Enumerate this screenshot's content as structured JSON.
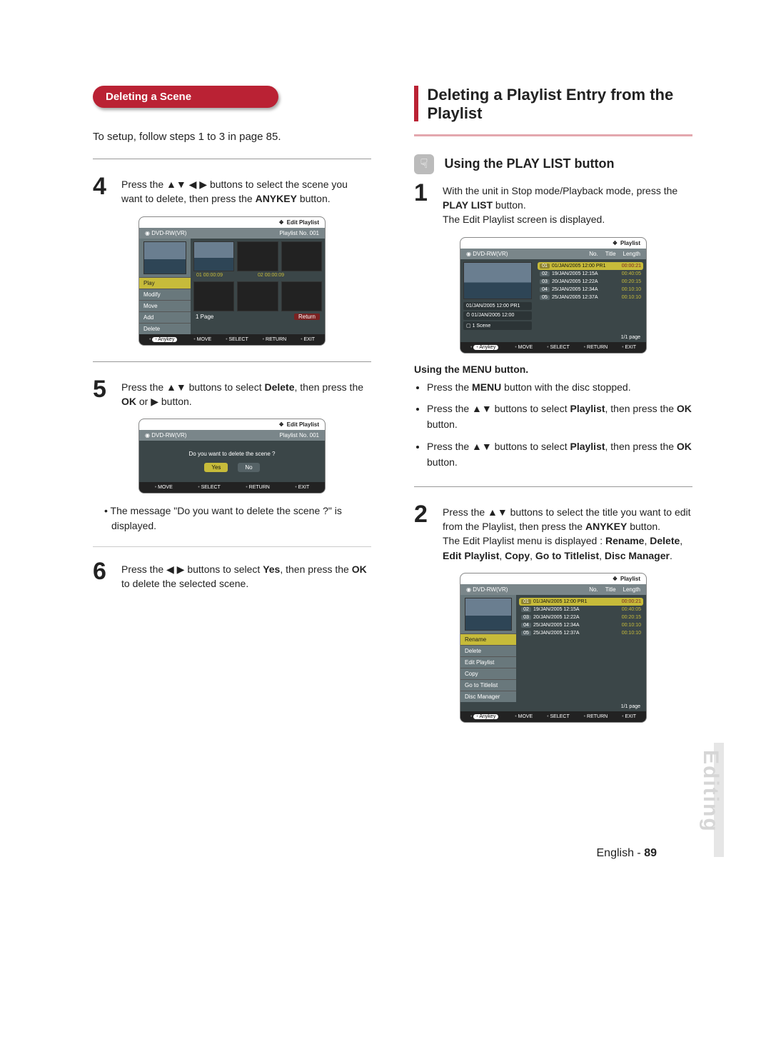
{
  "left": {
    "pill": "Deleting a Scene",
    "lead": "To setup, follow steps 1 to 3 in page 85.",
    "step4": {
      "num": "4",
      "body_pre": "Press the ▲▼ ◀ ▶ buttons to select the scene you want to delete, then press the ",
      "bold": "ANYKEY",
      "body_post": " button."
    },
    "step5": {
      "num": "5",
      "body_pre": "Press the ▲▼ buttons to select ",
      "bold1": "Delete",
      "mid": ", then press the ",
      "bold2": "OK",
      "mid2": " or ▶ button."
    },
    "note": "• The message \"Do you want to delete the scene ?\" is displayed.",
    "step6": {
      "num": "6",
      "body_pre": "Press the ◀ ▶ buttons to select ",
      "bold1": "Yes",
      "mid": ",\nthen press the ",
      "bold2": "OK",
      "post": " to delete the selected scene."
    }
  },
  "mini1": {
    "title": "Edit Playlist",
    "disc": "DVD-RW(VR)",
    "plist": "Playlist No. 001",
    "menu": [
      "Play",
      "Modify",
      "Move",
      "Add",
      "Delete"
    ],
    "pageinfo": "1 Page",
    "splits": [
      "00:00:09",
      "00:00:09"
    ],
    "foot_key": "Anykey",
    "foot": [
      "MOVE",
      "SELECT",
      "RETURN",
      "EXIT"
    ]
  },
  "mini2": {
    "title": "Edit Playlist",
    "disc": "DVD-RW(VR)",
    "plist": "Playlist No. 001",
    "msg": "Do you want to delete the scene ?",
    "yes": "Yes",
    "no": "No",
    "foot": [
      "MOVE",
      "SELECT",
      "RETURN",
      "EXIT"
    ]
  },
  "right": {
    "heading": "Deleting a Playlist Entry from the Playlist",
    "sub": "Using the PLAY LIST button",
    "step1": {
      "num": "1",
      "pre": "With the unit in Stop mode/Playback mode, press the ",
      "bold": "PLAY LIST",
      "mid": " button.",
      "line2": "The Edit Playlist screen is displayed."
    },
    "menutitle": "Using the MENU button.",
    "bullets": [
      "Press the MENU button with the disc stopped.",
      "Press the ▲▼ buttons to select Playlist, then press the OK button.",
      "Press the ▲▼ buttons to select Playlist, then press the OK button."
    ],
    "step2": {
      "num": "2",
      "line1": "Press the ▲▼ buttons to select the title you want to edit from the Playlist, then press the ANYKEY button.",
      "line2": "The Edit Playlist menu is displayed : Rename, Delete, Edit Playlist, Copy, Go to Titlelist, Disc Manager."
    }
  },
  "mini3": {
    "title": "Playlist",
    "disc": "DVD-RW(VR)",
    "cols": [
      "No.",
      "Title",
      "Length"
    ],
    "rows": [
      {
        "no": "01",
        "title": "01/JAN/2005 12:00 PR1",
        "len": "00:00:21"
      },
      {
        "no": "02",
        "title": "19/JAN/2005 12:15A",
        "len": "00:40:05"
      },
      {
        "no": "03",
        "title": "20/JAN/2005 12:22A",
        "len": "00:20:15"
      },
      {
        "no": "04",
        "title": "25/JAN/2005 12:34A",
        "len": "00:10:10"
      },
      {
        "no": "05",
        "title": "25/JAN/2005 12:37A",
        "len": "00:10:10"
      }
    ],
    "side": [
      "01/JAN/2005 12:00 PR1",
      "01/JAN/2005 12:00",
      "1 Scene"
    ],
    "page": "1/1 page",
    "foot_key": "Anykey",
    "foot": [
      "MOVE",
      "SELECT",
      "RETURN",
      "EXIT"
    ]
  },
  "mini4": {
    "title": "Playlist",
    "disc": "DVD-RW(VR)",
    "cols": [
      "No.",
      "Title",
      "Length"
    ],
    "rows": [
      {
        "no": "01",
        "title": "01/JAN/2005 12:00 PR1",
        "len": "00:00:21"
      },
      {
        "no": "02",
        "title": "19/JAN/2005 12:15A",
        "len": "00:40:05"
      },
      {
        "no": "03",
        "title": "20/JAN/2005 12:22A",
        "len": "00:20:15"
      },
      {
        "no": "04",
        "title": "25/JAN/2005 12:34A",
        "len": "00:10:10"
      },
      {
        "no": "05",
        "title": "25/JAN/2005 12:37A",
        "len": "00:10:10"
      }
    ],
    "menu": [
      "Rename",
      "Delete",
      "Edit Playlist",
      "Copy",
      "Go to Titlelist",
      "Disc Manager"
    ],
    "page": "1/1 page",
    "foot_key": "Anykey",
    "foot": [
      "MOVE",
      "SELECT",
      "RETURN",
      "EXIT"
    ]
  },
  "sidetab": "Editing",
  "footer": {
    "lang": "English",
    "sep": " - ",
    "page": "89"
  }
}
